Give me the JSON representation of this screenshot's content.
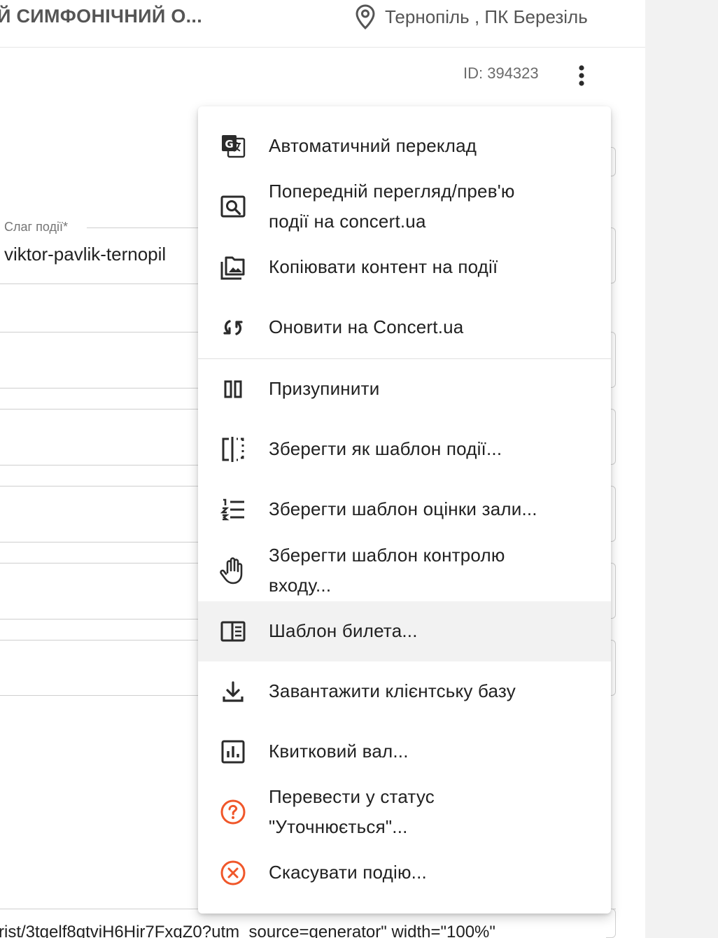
{
  "header": {
    "title": "Й СИМФОНІЧНИЙ О...",
    "location": "Тернопіль , ПК Березіль"
  },
  "event": {
    "id_label": "ID: 394323"
  },
  "form": {
    "slug_label": "Слаг події*",
    "slug_value": "viktor-pavlik-ternopil",
    "embed_code": "rist/3tgelf8gtviH6Hir7FxqZ0?utm_source=generator\" width=\"100%\""
  },
  "menu": {
    "items": [
      {
        "label": "Автоматичний переклад",
        "icon": "google-translate-icon"
      },
      {
        "label": "Попередній перегляд/прев'ю\nподії на concert.ua",
        "icon": "preview-search-icon"
      },
      {
        "label": "Копіювати контент на події",
        "icon": "copy-content-icon"
      },
      {
        "label": "Оновити на Concert.ua",
        "icon": "sync-icon"
      },
      {
        "label": "Призупинити",
        "icon": "pause-icon"
      },
      {
        "label": "Зберегти як шаблон події...",
        "icon": "template-split-icon"
      },
      {
        "label": "Зберегти шаблон оцінки зали...",
        "icon": "numbered-list-icon"
      },
      {
        "label": "Зберегти шаблон контролю\nвходу...",
        "icon": "hand-icon"
      },
      {
        "label": "Шаблон билета...",
        "icon": "ticket-template-icon"
      },
      {
        "label": "Завантажити клієнтську базу",
        "icon": "download-icon"
      },
      {
        "label": "Квитковий вал...",
        "icon": "bar-chart-icon"
      },
      {
        "label": "Перевести у статус\n\"Уточнюється\"...",
        "icon": "help-circle-icon"
      },
      {
        "label": "Скасувати подію...",
        "icon": "cancel-circle-icon"
      }
    ]
  },
  "colors": {
    "warning": "#f0572a",
    "icon": "#2b2b2b",
    "hover_bg": "#f2f2f2"
  }
}
